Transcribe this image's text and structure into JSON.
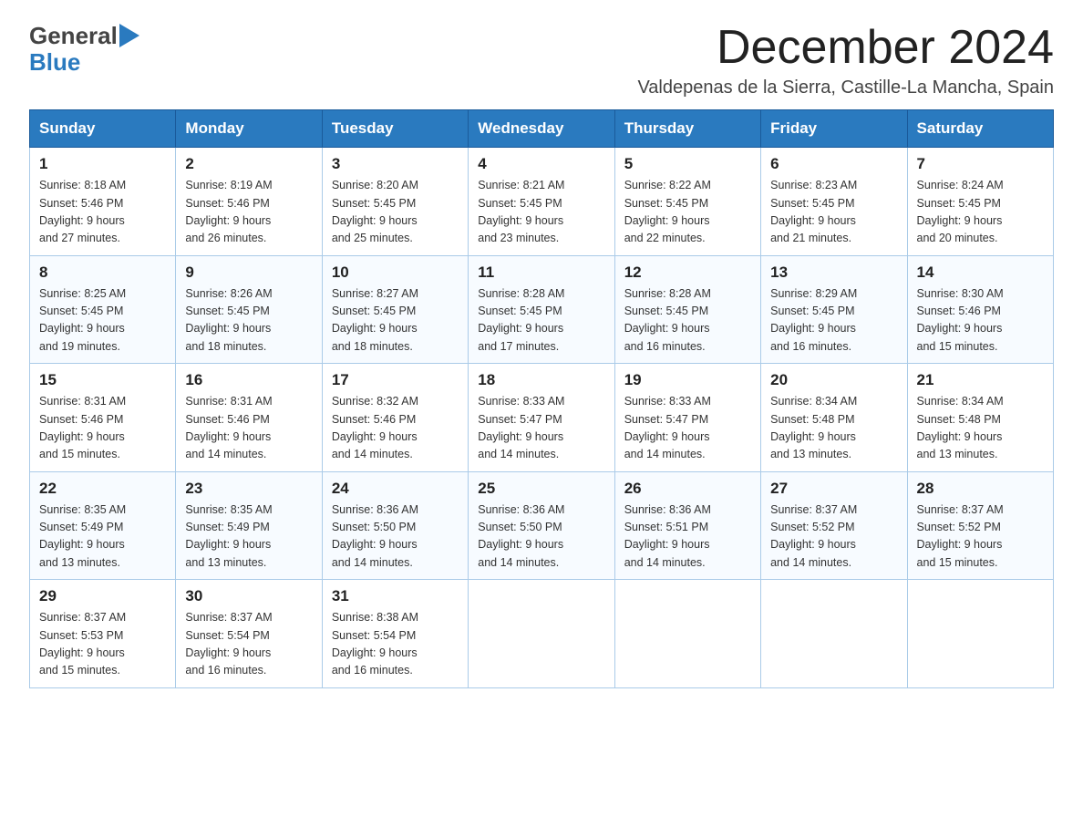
{
  "header": {
    "logo_general": "General",
    "logo_blue": "Blue",
    "month_title": "December 2024",
    "location": "Valdepenas de la Sierra, Castille-La Mancha, Spain"
  },
  "weekdays": [
    "Sunday",
    "Monday",
    "Tuesday",
    "Wednesday",
    "Thursday",
    "Friday",
    "Saturday"
  ],
  "weeks": [
    [
      {
        "day": "1",
        "sunrise": "8:18 AM",
        "sunset": "5:46 PM",
        "daylight": "9 hours and 27 minutes."
      },
      {
        "day": "2",
        "sunrise": "8:19 AM",
        "sunset": "5:46 PM",
        "daylight": "9 hours and 26 minutes."
      },
      {
        "day": "3",
        "sunrise": "8:20 AM",
        "sunset": "5:45 PM",
        "daylight": "9 hours and 25 minutes."
      },
      {
        "day": "4",
        "sunrise": "8:21 AM",
        "sunset": "5:45 PM",
        "daylight": "9 hours and 23 minutes."
      },
      {
        "day": "5",
        "sunrise": "8:22 AM",
        "sunset": "5:45 PM",
        "daylight": "9 hours and 22 minutes."
      },
      {
        "day": "6",
        "sunrise": "8:23 AM",
        "sunset": "5:45 PM",
        "daylight": "9 hours and 21 minutes."
      },
      {
        "day": "7",
        "sunrise": "8:24 AM",
        "sunset": "5:45 PM",
        "daylight": "9 hours and 20 minutes."
      }
    ],
    [
      {
        "day": "8",
        "sunrise": "8:25 AM",
        "sunset": "5:45 PM",
        "daylight": "9 hours and 19 minutes."
      },
      {
        "day": "9",
        "sunrise": "8:26 AM",
        "sunset": "5:45 PM",
        "daylight": "9 hours and 18 minutes."
      },
      {
        "day": "10",
        "sunrise": "8:27 AM",
        "sunset": "5:45 PM",
        "daylight": "9 hours and 18 minutes."
      },
      {
        "day": "11",
        "sunrise": "8:28 AM",
        "sunset": "5:45 PM",
        "daylight": "9 hours and 17 minutes."
      },
      {
        "day": "12",
        "sunrise": "8:28 AM",
        "sunset": "5:45 PM",
        "daylight": "9 hours and 16 minutes."
      },
      {
        "day": "13",
        "sunrise": "8:29 AM",
        "sunset": "5:45 PM",
        "daylight": "9 hours and 16 minutes."
      },
      {
        "day": "14",
        "sunrise": "8:30 AM",
        "sunset": "5:46 PM",
        "daylight": "9 hours and 15 minutes."
      }
    ],
    [
      {
        "day": "15",
        "sunrise": "8:31 AM",
        "sunset": "5:46 PM",
        "daylight": "9 hours and 15 minutes."
      },
      {
        "day": "16",
        "sunrise": "8:31 AM",
        "sunset": "5:46 PM",
        "daylight": "9 hours and 14 minutes."
      },
      {
        "day": "17",
        "sunrise": "8:32 AM",
        "sunset": "5:46 PM",
        "daylight": "9 hours and 14 minutes."
      },
      {
        "day": "18",
        "sunrise": "8:33 AM",
        "sunset": "5:47 PM",
        "daylight": "9 hours and 14 minutes."
      },
      {
        "day": "19",
        "sunrise": "8:33 AM",
        "sunset": "5:47 PM",
        "daylight": "9 hours and 14 minutes."
      },
      {
        "day": "20",
        "sunrise": "8:34 AM",
        "sunset": "5:48 PM",
        "daylight": "9 hours and 13 minutes."
      },
      {
        "day": "21",
        "sunrise": "8:34 AM",
        "sunset": "5:48 PM",
        "daylight": "9 hours and 13 minutes."
      }
    ],
    [
      {
        "day": "22",
        "sunrise": "8:35 AM",
        "sunset": "5:49 PM",
        "daylight": "9 hours and 13 minutes."
      },
      {
        "day": "23",
        "sunrise": "8:35 AM",
        "sunset": "5:49 PM",
        "daylight": "9 hours and 13 minutes."
      },
      {
        "day": "24",
        "sunrise": "8:36 AM",
        "sunset": "5:50 PM",
        "daylight": "9 hours and 14 minutes."
      },
      {
        "day": "25",
        "sunrise": "8:36 AM",
        "sunset": "5:50 PM",
        "daylight": "9 hours and 14 minutes."
      },
      {
        "day": "26",
        "sunrise": "8:36 AM",
        "sunset": "5:51 PM",
        "daylight": "9 hours and 14 minutes."
      },
      {
        "day": "27",
        "sunrise": "8:37 AM",
        "sunset": "5:52 PM",
        "daylight": "9 hours and 14 minutes."
      },
      {
        "day": "28",
        "sunrise": "8:37 AM",
        "sunset": "5:52 PM",
        "daylight": "9 hours and 15 minutes."
      }
    ],
    [
      {
        "day": "29",
        "sunrise": "8:37 AM",
        "sunset": "5:53 PM",
        "daylight": "9 hours and 15 minutes."
      },
      {
        "day": "30",
        "sunrise": "8:37 AM",
        "sunset": "5:54 PM",
        "daylight": "9 hours and 16 minutes."
      },
      {
        "day": "31",
        "sunrise": "8:38 AM",
        "sunset": "5:54 PM",
        "daylight": "9 hours and 16 minutes."
      },
      null,
      null,
      null,
      null
    ]
  ],
  "labels": {
    "sunrise": "Sunrise:",
    "sunset": "Sunset:",
    "daylight": "Daylight:"
  }
}
